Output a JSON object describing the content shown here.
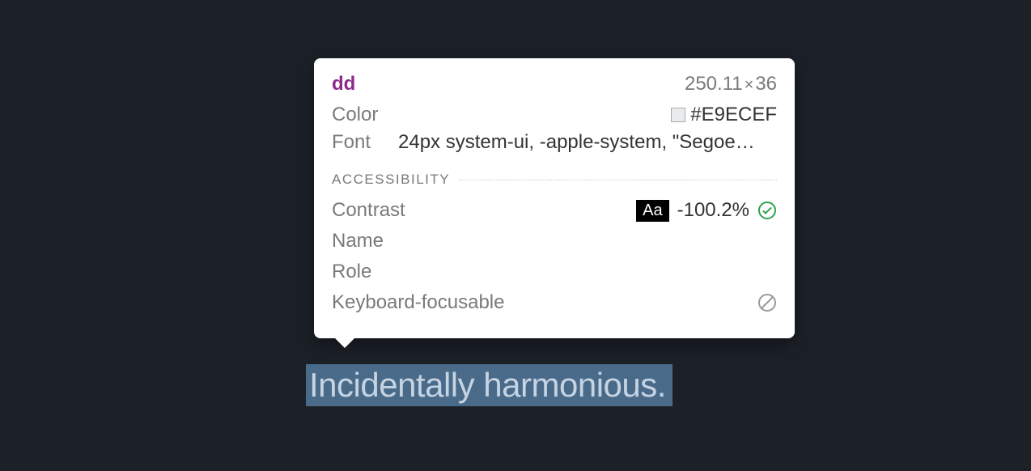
{
  "tooltip": {
    "element_tag": "dd",
    "dimensions_width": "250.11",
    "dimensions_height": "36",
    "color_label": "Color",
    "color_value": "#E9ECEF",
    "font_label": "Font",
    "font_value": "24px system-ui, -apple-system, \"Segoe…",
    "accessibility_header": "ACCESSIBILITY",
    "contrast_label": "Contrast",
    "contrast_sample": "Aa",
    "contrast_value": "-100.2%",
    "name_label": "Name",
    "role_label": "Role",
    "keyboard_focusable_label": "Keyboard-focusable"
  },
  "highlighted_text": "Incidentally harmonious.",
  "colors": {
    "swatch": "#E9ECEF"
  }
}
